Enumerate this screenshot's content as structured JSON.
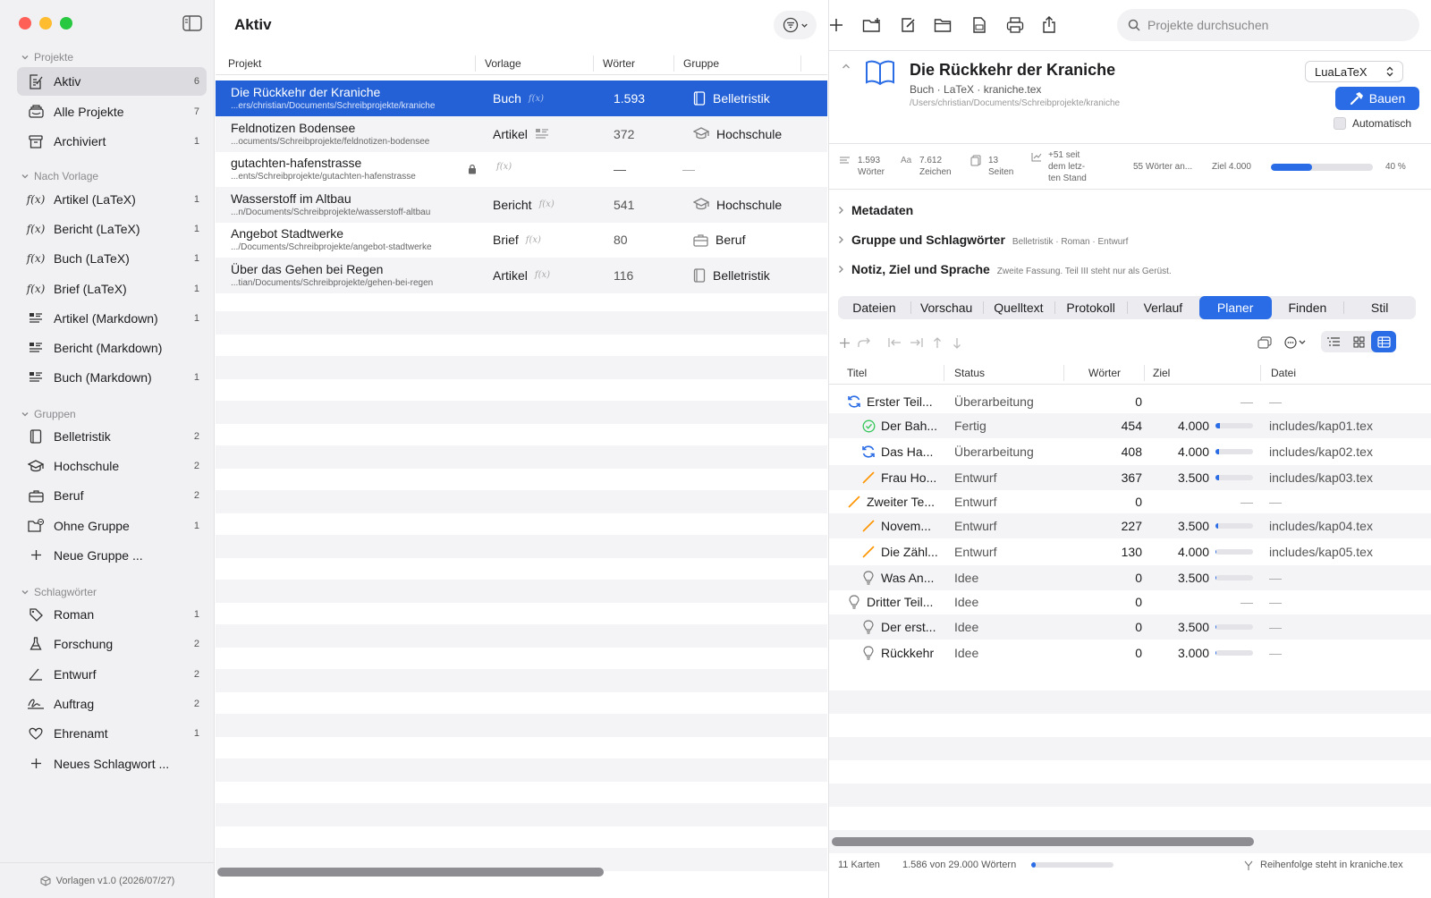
{
  "colors": {
    "accent": "#2a6ce6",
    "selection": "#2461d6",
    "close": "#fe5f57",
    "minimize": "#febc2e",
    "zoom": "#28c840",
    "status_done": "#34c759",
    "status_review": "#2a6ce6",
    "status_draft": "#ff9500"
  },
  "sidebar": {
    "sections": {
      "projects": "Projekte",
      "templates": "Nach Vorlage",
      "groups": "Gruppen",
      "tags": "Schlagwörter"
    },
    "projects": [
      {
        "icon": "pencil-doc-icon",
        "label": "Aktiv",
        "count": "6"
      },
      {
        "icon": "stack-icon",
        "label": "Alle Projekte",
        "count": "7"
      },
      {
        "icon": "archive-icon",
        "label": "Archiviert",
        "count": "1"
      }
    ],
    "templates": [
      {
        "icon": "function-icon",
        "glyph": "f(x)",
        "label": "Artikel (LaTeX)",
        "count": "1"
      },
      {
        "icon": "function-icon",
        "glyph": "f(x)",
        "label": "Bericht (LaTeX)",
        "count": "1"
      },
      {
        "icon": "function-icon",
        "glyph": "f(x)",
        "label": "Buch (LaTeX)",
        "count": "1"
      },
      {
        "icon": "function-icon",
        "glyph": "f(x)",
        "label": "Brief (LaTeX)",
        "count": "1"
      },
      {
        "icon": "markdown-icon",
        "label": "Artikel (Markdown)",
        "count": "1"
      },
      {
        "icon": "markdown-icon",
        "label": "Bericht (Markdown)",
        "count": ""
      },
      {
        "icon": "markdown-icon",
        "label": "Buch (Markdown)",
        "count": "1"
      }
    ],
    "groups": [
      {
        "icon": "book-icon",
        "label": "Belletristik",
        "count": "2"
      },
      {
        "icon": "graduation-cap-icon",
        "label": "Hochschule",
        "count": "2"
      },
      {
        "icon": "briefcase-icon",
        "label": "Beruf",
        "count": "2"
      },
      {
        "icon": "folder-badge-icon",
        "label": "Ohne Gruppe",
        "count": "1"
      },
      {
        "icon": "plus-icon",
        "label": "Neue Gruppe ...",
        "count": ""
      }
    ],
    "tags": [
      {
        "icon": "tag-icon",
        "label": "Roman",
        "count": "1"
      },
      {
        "icon": "flask-icon",
        "label": "Forschung",
        "count": "2"
      },
      {
        "icon": "angle-icon",
        "label": "Entwurf",
        "count": "2"
      },
      {
        "icon": "signature-icon",
        "label": "Auftrag",
        "count": "2"
      },
      {
        "icon": "heart-icon",
        "label": "Ehrenamt",
        "count": "1"
      },
      {
        "icon": "plus-icon",
        "label": "Neues Schlagwort ...",
        "count": ""
      }
    ],
    "footer": "Vorlagen v1.0 (2026/07/27)"
  },
  "list": {
    "title": "Aktiv",
    "columns": {
      "project": "Projekt",
      "template": "Vorlage",
      "words": "Wörter",
      "group": "Gruppe"
    },
    "rows": [
      {
        "name": "Die Rückkehr der Kraniche",
        "path": "...ers/christian/Documents/Schreibprojekte/kraniche",
        "template": "Buch",
        "template_icon": "function-icon",
        "words": "1.593",
        "group": "Belletristik",
        "group_icon": "book-icon"
      },
      {
        "name": "Feldnotizen Bodensee",
        "path": "...ocuments/Schreibprojekte/feldnotizen-bodensee",
        "template": "Artikel",
        "template_icon": "markdown-icon",
        "words": "372",
        "group": "Hochschule",
        "group_icon": "graduation-cap-icon"
      },
      {
        "name": "gutachten-hafenstrasse",
        "path": "...ents/Schreibprojekte/gutachten-hafenstrasse",
        "template": "",
        "template_icon": "function-icon",
        "words": "—",
        "group": "—",
        "group_icon": "",
        "locked": true
      },
      {
        "name": "Wasserstoff im Altbau",
        "path": "...n/Documents/Schreibprojekte/wasserstoff-altbau",
        "template": "Bericht",
        "template_icon": "function-icon",
        "words": "541",
        "group": "Hochschule",
        "group_icon": "graduation-cap-icon"
      },
      {
        "name": "Angebot Stadtwerke",
        "path": ".../Documents/Schreibprojekte/angebot-stadtwerke",
        "template": "Brief",
        "template_icon": "function-icon",
        "words": "80",
        "group": "Beruf",
        "group_icon": "briefcase-icon"
      },
      {
        "name": "Über das Gehen bei Regen",
        "path": "...tian/Documents/Schreibprojekte/gehen-bei-regen",
        "template": "Artikel",
        "template_icon": "function-icon",
        "words": "116",
        "group": "Belletristik",
        "group_icon": "book-icon"
      }
    ]
  },
  "detail": {
    "search_placeholder": "Projekte durchsuchen",
    "title": "Die Rückkehr der Kraniche",
    "subtitle": "Buch · LaTeX · kraniche.tex",
    "path": "/Users/christian/Documents/Schreibprojekte/kraniche",
    "engine": "LuaLaTeX",
    "build": "Bauen",
    "auto": "Automatisch",
    "stats": {
      "words_n": "1.593",
      "words_l": "Wörter",
      "chars_n": "7.612",
      "chars_l": "Zeichen",
      "pages_n": "13",
      "pages_l": "Seiten",
      "delta_1": "+51 seit",
      "delta_2": "dem letz-",
      "delta_3": "ten Stand",
      "today": "55 Wörter an...",
      "goal": "Ziel 4.000",
      "percent": "40 %",
      "progress": 0.4
    },
    "sections": [
      {
        "title": "Metadaten",
        "summary": ""
      },
      {
        "title": "Gruppe und Schlagwörter",
        "summary": "Belletristik · Roman · Entwurf"
      },
      {
        "title": "Notiz, Ziel und Sprache",
        "summary": "Zweite Fassung. Teil III steht nur als Gerüst."
      }
    ],
    "tabs": [
      "Dateien",
      "Vorschau",
      "Quelltext",
      "Protokoll",
      "Verlauf",
      "Planer",
      "Finden",
      "Stil"
    ],
    "active_tab": "Planer",
    "planner_columns": {
      "title": "Titel",
      "status": "Status",
      "words": "Wörter",
      "goal": "Ziel",
      "file": "Datei"
    },
    "planner": [
      {
        "level": 0,
        "icon": "refresh-icon",
        "title": "Erster Teil...",
        "status": "Überarbeitung",
        "words": "0",
        "goal": "",
        "progress": null,
        "file": "—"
      },
      {
        "level": 1,
        "icon": "check-circle-icon",
        "title": "Der Bah...",
        "status": "Fertig",
        "words": "454",
        "goal": "4.000",
        "progress": 0.11,
        "file": "includes/kap01.tex"
      },
      {
        "level": 1,
        "icon": "refresh-icon",
        "title": "Das Ha...",
        "status": "Überarbeitung",
        "words": "408",
        "goal": "4.000",
        "progress": 0.1,
        "file": "includes/kap02.tex"
      },
      {
        "level": 1,
        "icon": "pencil-icon",
        "title": "Frau Ho...",
        "status": "Entwurf",
        "words": "367",
        "goal": "3.500",
        "progress": 0.1,
        "file": "includes/kap03.tex"
      },
      {
        "level": 0,
        "icon": "pencil-icon",
        "title": "Zweiter Te...",
        "status": "Entwurf",
        "words": "0",
        "goal": "",
        "progress": null,
        "file": "—"
      },
      {
        "level": 1,
        "icon": "pencil-icon",
        "title": "Novem...",
        "status": "Entwurf",
        "words": "227",
        "goal": "3.500",
        "progress": 0.06,
        "file": "includes/kap04.tex"
      },
      {
        "level": 1,
        "icon": "pencil-icon",
        "title": "Die Zähl...",
        "status": "Entwurf",
        "words": "130",
        "goal": "4.000",
        "progress": 0.03,
        "file": "includes/kap05.tex"
      },
      {
        "level": 1,
        "icon": "lightbulb-icon",
        "title": "Was An...",
        "status": "Idee",
        "words": "0",
        "goal": "3.500",
        "progress": 0.0,
        "file": "—"
      },
      {
        "level": 0,
        "icon": "lightbulb-icon",
        "title": "Dritter Teil...",
        "status": "Idee",
        "words": "0",
        "goal": "",
        "progress": null,
        "file": "—"
      },
      {
        "level": 1,
        "icon": "lightbulb-icon",
        "title": "Der erst...",
        "status": "Idee",
        "words": "0",
        "goal": "3.500",
        "progress": 0.0,
        "file": "—"
      },
      {
        "level": 1,
        "icon": "lightbulb-icon",
        "title": "Rückkehr",
        "status": "Idee",
        "words": "0",
        "goal": "3.000",
        "progress": 0.0,
        "file": "—"
      }
    ],
    "footer": {
      "cards": "11 Karten",
      "total": "1.586 von 29.000 Wörtern",
      "total_progress": 0.055,
      "order": "Reihenfolge steht in kraniche.tex"
    }
  }
}
